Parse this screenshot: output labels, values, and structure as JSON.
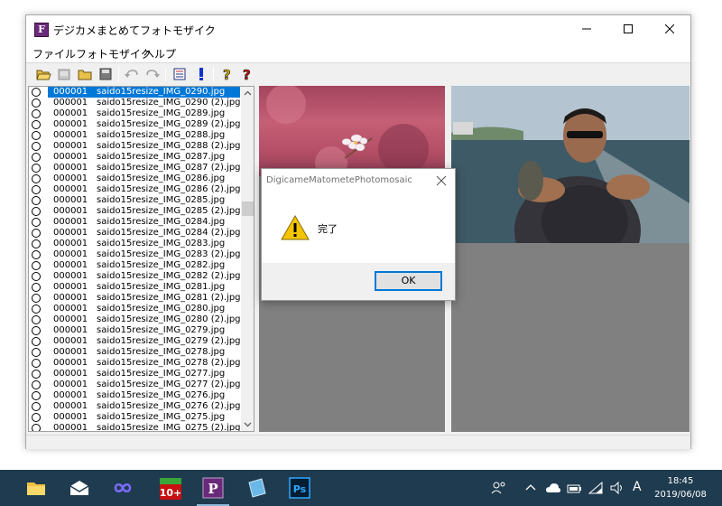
{
  "window": {
    "title": "デジカメまとめてフォトモザイク",
    "app_icon_letter": "F"
  },
  "menu": [
    "ファイル",
    "フォトモザイク",
    "ヘルプ"
  ],
  "toolbar": {
    "buttons": [
      "open-folder-icon",
      "save-image-icon",
      "folder-icon",
      "save-disk-icon",
      "undo-icon",
      "redo-icon",
      "list-icon",
      "exclamation-icon",
      "help-icon",
      "help-context-icon"
    ]
  },
  "file_list": {
    "rows": [
      {
        "num": "000001",
        "name": "saido15resize_IMG_0290.jpg",
        "selected": true
      },
      {
        "num": "000001",
        "name": "saido15resize_IMG_0290 (2).jpg"
      },
      {
        "num": "000001",
        "name": "saido15resize_IMG_0289.jpg"
      },
      {
        "num": "000001",
        "name": "saido15resize_IMG_0289 (2).jpg"
      },
      {
        "num": "000001",
        "name": "saido15resize_IMG_0288.jpg"
      },
      {
        "num": "000001",
        "name": "saido15resize_IMG_0288 (2).jpg"
      },
      {
        "num": "000001",
        "name": "saido15resize_IMG_0287.jpg"
      },
      {
        "num": "000001",
        "name": "saido15resize_IMG_0287 (2).jpg"
      },
      {
        "num": "000001",
        "name": "saido15resize_IMG_0286.jpg"
      },
      {
        "num": "000001",
        "name": "saido15resize_IMG_0286 (2).jpg"
      },
      {
        "num": "000001",
        "name": "saido15resize_IMG_0285.jpg"
      },
      {
        "num": "000001",
        "name": "saido15resize_IMG_0285 (2).jpg"
      },
      {
        "num": "000001",
        "name": "saido15resize_IMG_0284.jpg"
      },
      {
        "num": "000001",
        "name": "saido15resize_IMG_0284 (2).jpg"
      },
      {
        "num": "000001",
        "name": "saido15resize_IMG_0283.jpg"
      },
      {
        "num": "000001",
        "name": "saido15resize_IMG_0283 (2).jpg"
      },
      {
        "num": "000001",
        "name": "saido15resize_IMG_0282.jpg"
      },
      {
        "num": "000001",
        "name": "saido15resize_IMG_0282 (2).jpg"
      },
      {
        "num": "000001",
        "name": "saido15resize_IMG_0281.jpg"
      },
      {
        "num": "000001",
        "name": "saido15resize_IMG_0281 (2).jpg"
      },
      {
        "num": "000001",
        "name": "saido15resize_IMG_0280.jpg"
      },
      {
        "num": "000001",
        "name": "saido15resize_IMG_0280 (2).jpg"
      },
      {
        "num": "000001",
        "name": "saido15resize_IMG_0279.jpg"
      },
      {
        "num": "000001",
        "name": "saido15resize_IMG_0279 (2).jpg"
      },
      {
        "num": "000001",
        "name": "saido15resize_IMG_0278.jpg"
      },
      {
        "num": "000001",
        "name": "saido15resize_IMG_0278 (2).jpg"
      },
      {
        "num": "000001",
        "name": "saido15resize_IMG_0277.jpg"
      },
      {
        "num": "000001",
        "name": "saido15resize_IMG_0277 (2).jpg"
      },
      {
        "num": "000001",
        "name": "saido15resize_IMG_0276.jpg"
      },
      {
        "num": "000001",
        "name": "saido15resize_IMG_0276 (2).jpg"
      },
      {
        "num": "000001",
        "name": "saido15resize_IMG_0275.jpg"
      },
      {
        "num": "000001",
        "name": "saido15resize_IMG_0275 (2).jpg"
      }
    ]
  },
  "dialog": {
    "title": "DigicameMatometePhotomosaic",
    "message": "完了",
    "ok_label": "OK"
  },
  "taskbar": {
    "apps": [
      "file-explorer-icon",
      "mail-icon",
      "infinity-app-icon",
      "calendar-app-icon",
      "photomosaic-app-icon",
      "notes-app-icon",
      "photoshop-icon"
    ],
    "calendar_badge": "10+",
    "photomosaic_letter": "P",
    "photoshop_label": "Ps",
    "ime_indicator": "A",
    "time": "18:45",
    "date": "2019/06/08"
  },
  "colors": {
    "selection": "#0078d7",
    "taskbar": "#1f3b4f",
    "panel_gray": "#808080"
  }
}
